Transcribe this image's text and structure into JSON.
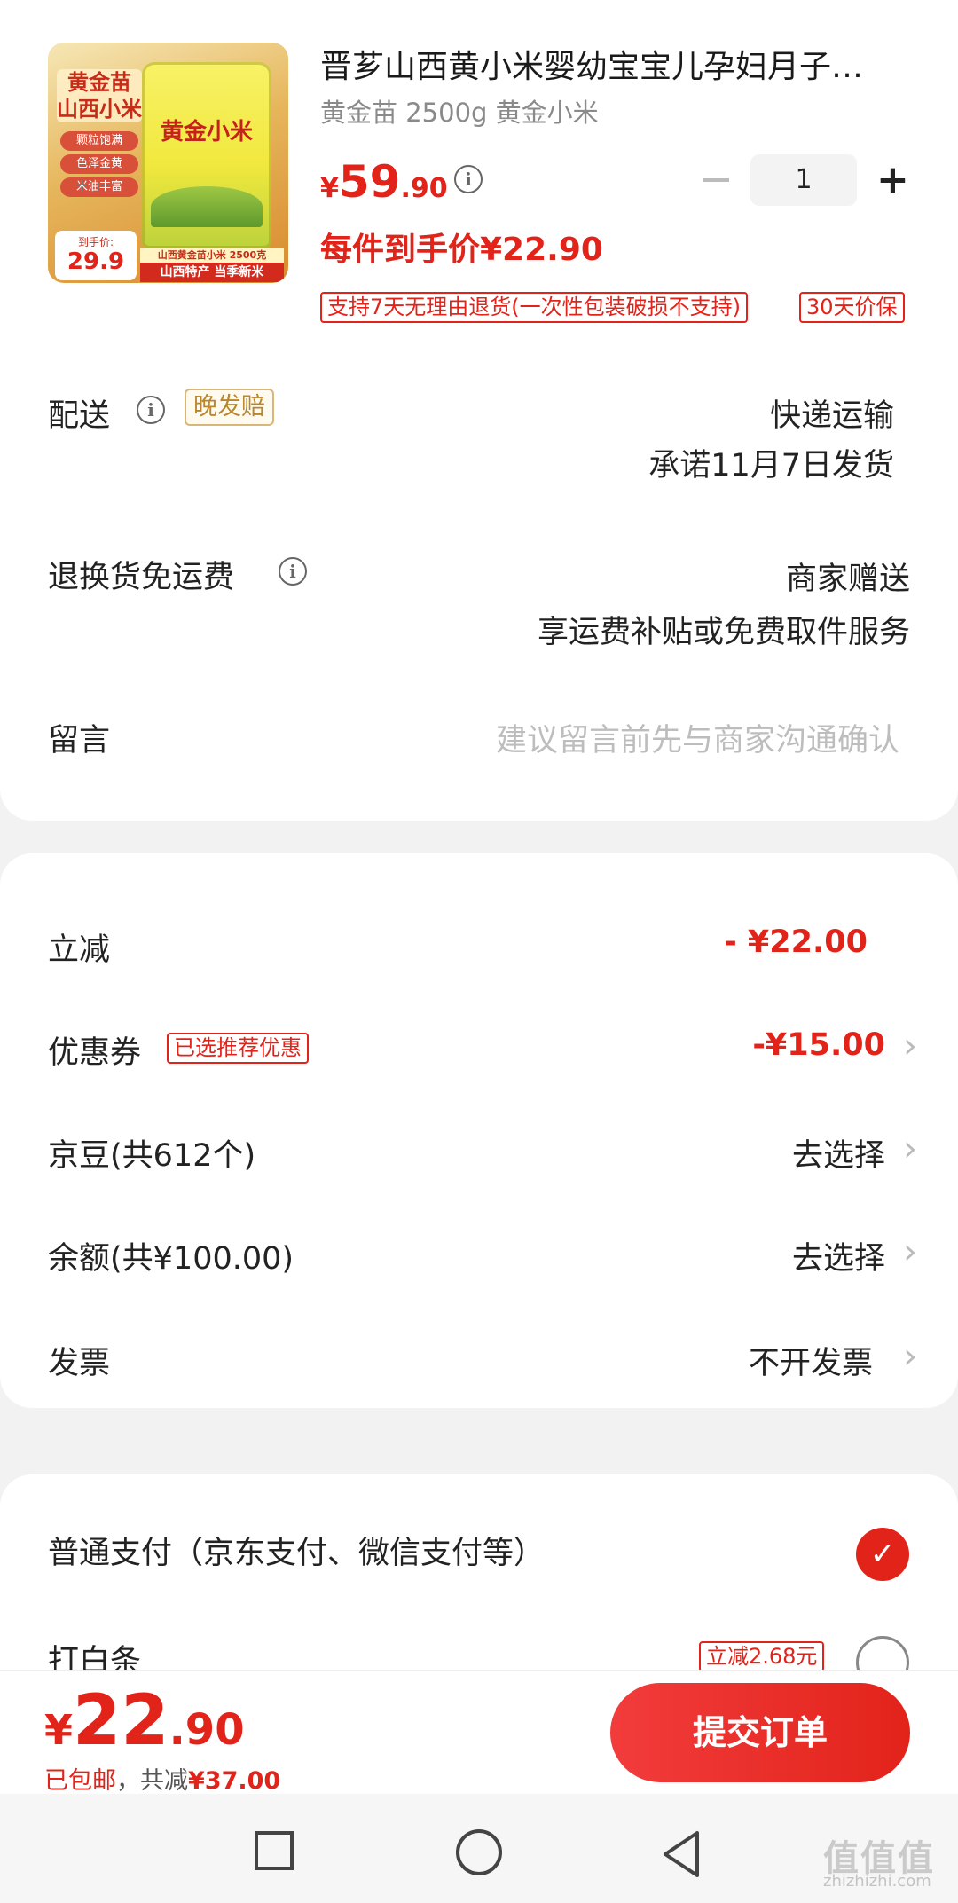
{
  "product": {
    "image": {
      "brand": "黄金苗",
      "name": "山西小米",
      "features": [
        "颗粒饱满",
        "色泽金黄",
        "米油丰富"
      ],
      "bag_label": "黄金小米",
      "price_label": "到手价:",
      "price": "29.9",
      "banner_top": "山西黄金苗小米 2500克",
      "banner_bottom": "山西特产 当季新米"
    },
    "title": "晋芗山西黄小米婴幼宝宝儿孕妇月子…",
    "spec": "黄金苗 2500g 黄金小米",
    "price": {
      "currency": "¥",
      "int": "59",
      "dec": ".90"
    },
    "quantity": "1",
    "deal_price": "每件到手价¥22.90",
    "tags": [
      "支持7天无理由退货(一次性包装破损不支持)",
      "30天价保"
    ]
  },
  "delivery": {
    "label": "配送",
    "badge": "晚发赔",
    "method": "快递运输",
    "date": "承诺11月7日发货"
  },
  "returns": {
    "label": "退换货免运费",
    "value": "商家赠送",
    "desc": "享运费补贴或免费取件服务"
  },
  "message": {
    "label": "留言",
    "placeholder": "建议留言前先与商家沟通确认"
  },
  "discounts": {
    "instant": {
      "label": "立减",
      "value": "- ¥22.00"
    },
    "coupon": {
      "label": "优惠券",
      "badge": "已选推荐优惠",
      "value": "-¥15.00"
    },
    "jingdou": {
      "label": "京豆(共612个)",
      "value": "去选择"
    },
    "balance": {
      "label": "余额(共¥100.00)",
      "value": "去选择"
    },
    "invoice": {
      "label": "发票",
      "value": "不开发票"
    }
  },
  "payment": {
    "normal": {
      "label": "普通支付（京东支付、微信支付等）",
      "selected": true
    },
    "baitiao": {
      "label": "打白条",
      "badge": "立减2.68元",
      "selected": false
    }
  },
  "footer": {
    "total": {
      "currency": "¥",
      "int": "22",
      "dec": ".90"
    },
    "shipping": "已包邮",
    "sep": "，",
    "saved_label": "共减",
    "saved_value": "¥37.00",
    "submit": "提交订单"
  },
  "watermark": {
    "main": "值值值",
    "sub": "zhizhizhi.com"
  },
  "colors": {
    "accent": "#e2231a",
    "gold": "#b8862d"
  }
}
